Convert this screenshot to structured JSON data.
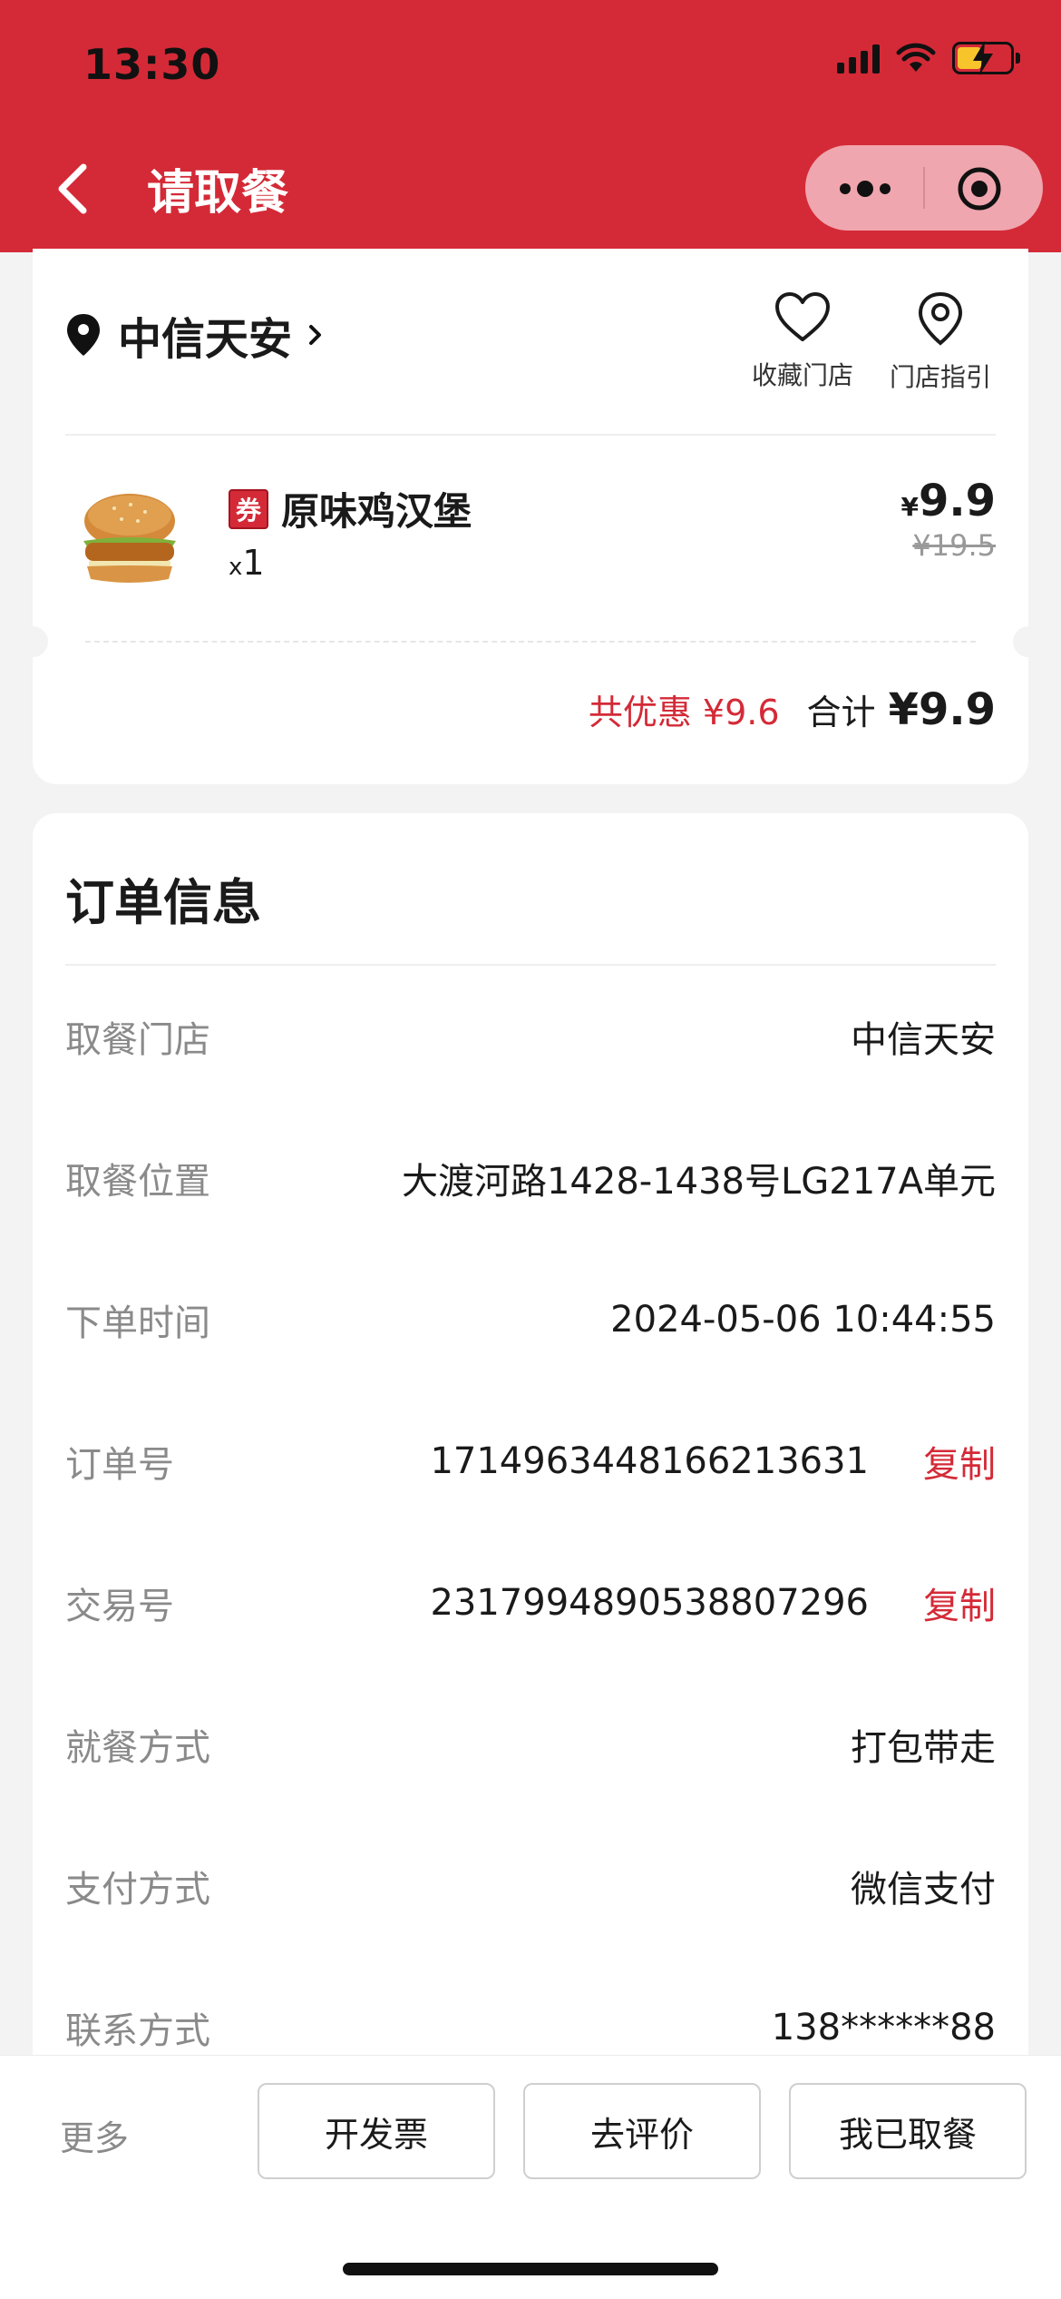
{
  "status_bar": {
    "time": "13:30"
  },
  "header": {
    "title": "请取餐"
  },
  "store": {
    "name": "中信天安",
    "actions": [
      {
        "label": "收藏门店",
        "icon": "heart-icon"
      },
      {
        "label": "门店指引",
        "icon": "location-pin-icon"
      }
    ]
  },
  "order_item": {
    "coupon_tag": "券",
    "name": "原味鸡汉堡",
    "qty_prefix": "x",
    "qty": "1",
    "currency": "¥",
    "price": "9.9",
    "original_price": "¥19.5"
  },
  "summary": {
    "discount": "共优惠 ¥9.6",
    "total_label": "合计",
    "total_value": "¥9.9"
  },
  "order_info": {
    "title": "订单信息",
    "rows": [
      {
        "key": "取餐门店",
        "value": "中信天安"
      },
      {
        "key": "取餐位置",
        "value": "大渡河路1428-1438号LG217A单元"
      },
      {
        "key": "下单时间",
        "value": "2024-05-06 10:44:55"
      },
      {
        "key": "订单号",
        "value": "1714963448166213631",
        "action": "复制"
      },
      {
        "key": "交易号",
        "value": "2317994890538807296",
        "action": "复制"
      },
      {
        "key": "就餐方式",
        "value": "打包带走"
      },
      {
        "key": "支付方式",
        "value": "微信支付"
      },
      {
        "key": "联系方式",
        "value": "138******88"
      }
    ]
  },
  "bottom_bar": {
    "more": "更多",
    "buttons": [
      "开发票",
      "去评价",
      "我已取餐"
    ]
  },
  "colors": {
    "brand_red": "#d42a37",
    "capsule": "#f0a6ae"
  }
}
